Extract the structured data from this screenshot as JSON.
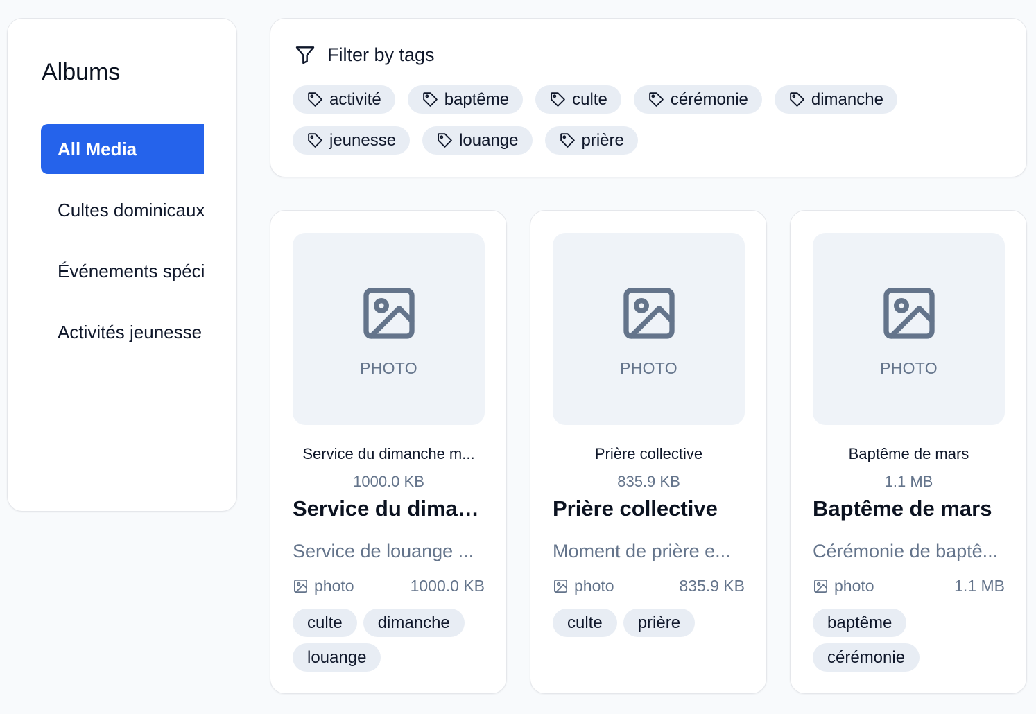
{
  "sidebar": {
    "title": "Albums",
    "items": [
      {
        "label": "All Media",
        "active": true
      },
      {
        "label": "Cultes dominicaux",
        "active": false
      },
      {
        "label": "Événements spéciaux",
        "active": false
      },
      {
        "label": "Activités jeunesse",
        "active": false
      }
    ]
  },
  "filter": {
    "title": "Filter by tags",
    "tags": [
      "activité",
      "baptême",
      "culte",
      "cérémonie",
      "dimanche",
      "jeunesse",
      "louange",
      "prière"
    ]
  },
  "cards": [
    {
      "thumb_label": "PHOTO",
      "caption_title": "Service du dimanche m...",
      "caption_size": "1000.0 KB",
      "title": "Service du diman...",
      "description": "Service de louange ...",
      "type": "photo",
      "size": "1000.0 KB",
      "tags": [
        "culte",
        "dimanche",
        "louange"
      ]
    },
    {
      "thumb_label": "PHOTO",
      "caption_title": "Prière collective",
      "caption_size": "835.9 KB",
      "title": "Prière collective",
      "description": "Moment de prière e...",
      "type": "photo",
      "size": "835.9 KB",
      "tags": [
        "culte",
        "prière"
      ]
    },
    {
      "thumb_label": "PHOTO",
      "caption_title": "Baptême de mars",
      "caption_size": "1.1 MB",
      "title": "Baptême de mars",
      "description": "Cérémonie de baptê...",
      "type": "photo",
      "size": "1.1 MB",
      "tags": [
        "baptême",
        "cérémonie"
      ]
    }
  ],
  "colors": {
    "accent": "#2563eb",
    "chip_bg": "#e8edf4",
    "muted_text": "#64748b",
    "icon": "#64748b"
  },
  "icons": {
    "filter": "filter-icon",
    "tag": "tag-icon",
    "image": "image-icon"
  }
}
